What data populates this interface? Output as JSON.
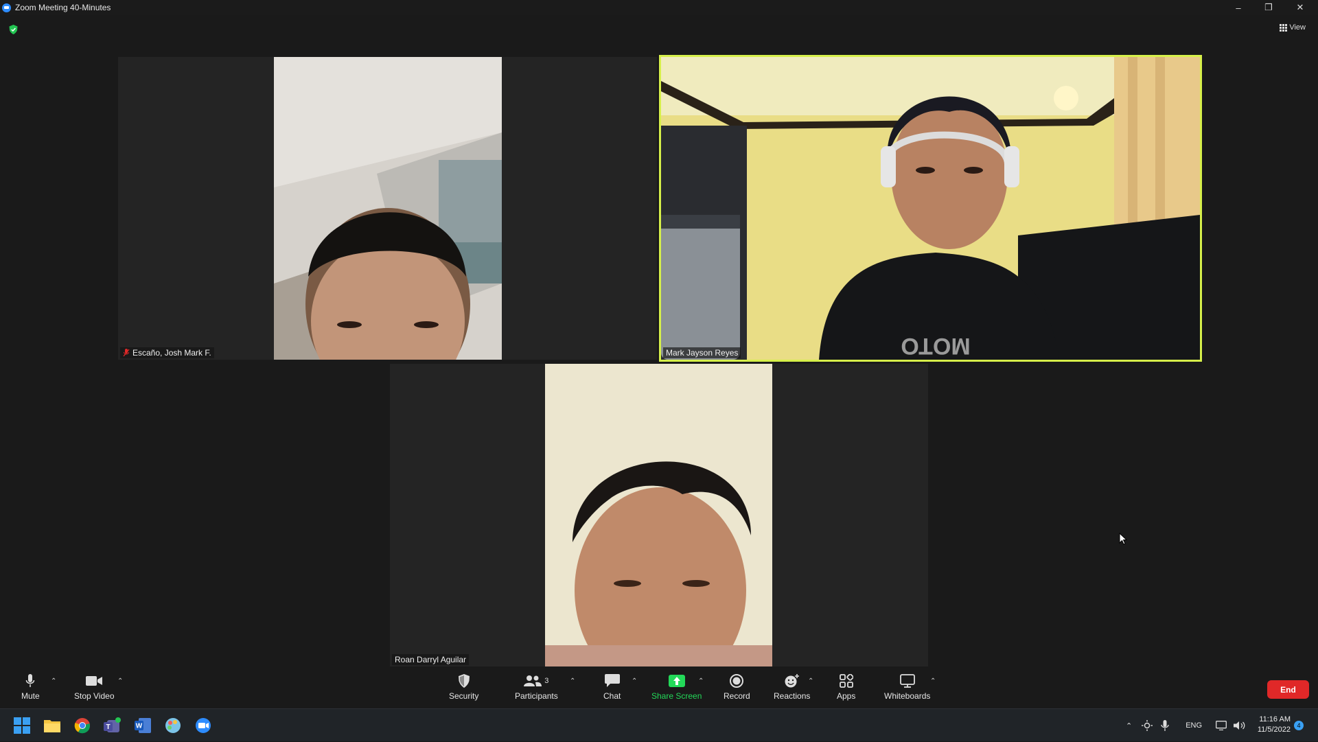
{
  "window": {
    "title": "Zoom Meeting 40-Minutes",
    "minimize": "–",
    "restore": "❐",
    "close": "✕"
  },
  "view_button": {
    "label": "View"
  },
  "participants": [
    {
      "name": "Escaño, Josh Mark F.",
      "muted": true,
      "active_speaker": false
    },
    {
      "name": "Mark Jayson Reyes",
      "muted": false,
      "active_speaker": true
    },
    {
      "name": "Roan Darryl Aguilar",
      "muted": false,
      "active_speaker": false
    }
  ],
  "toolbar": {
    "mute": "Mute",
    "stop_video": "Stop Video",
    "security": "Security",
    "participants": "Participants",
    "participants_count": "3",
    "chat": "Chat",
    "share_screen": "Share Screen",
    "record": "Record",
    "reactions": "Reactions",
    "apps": "Apps",
    "whiteboards": "Whiteboards",
    "end": "End"
  },
  "taskbar": {
    "apps": [
      "start-icon",
      "file-explorer-icon",
      "chrome-icon",
      "teams-icon",
      "word-icon",
      "paint-icon",
      "zoom-icon"
    ],
    "language": "ENG",
    "time": "11:16 AM",
    "date": "11/5/2022",
    "notification_count": "4"
  },
  "colors": {
    "active_speaker_border": "#d6f04a",
    "share_screen_green": "#23d959",
    "end_red": "#e02828",
    "zoom_blue": "#2d8cff"
  }
}
